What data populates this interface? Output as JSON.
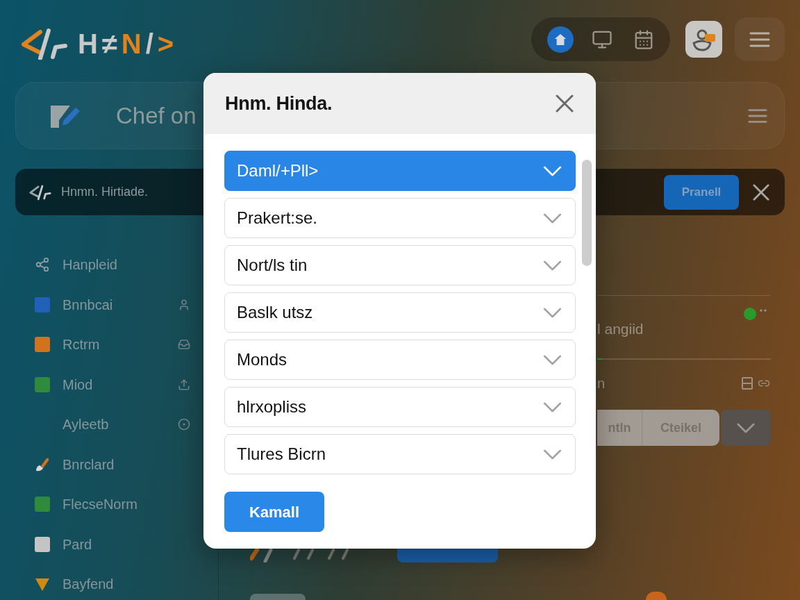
{
  "logo": {
    "parts": [
      {
        "text": "H≠",
        "color": "#c9c9c9"
      },
      {
        "text": "N",
        "color": "#e0831c"
      },
      {
        "text": "/",
        "color": "#c9c9c9"
      },
      {
        "text": ">",
        "color": "#e0831c"
      }
    ]
  },
  "toolbar": [
    {
      "kind": "home",
      "selected": true
    },
    {
      "kind": "monitor",
      "selected": false
    },
    {
      "kind": "calendar",
      "selected": false
    }
  ],
  "page_header": {
    "title": "Chef on"
  },
  "notice_bar": {
    "text": "Hnmn. Hirtiade.",
    "button": "Pranell"
  },
  "sidebar": {
    "items": [
      {
        "label": "Hanpleid",
        "kind": "share"
      },
      {
        "label": "Bnnbcai",
        "kind": "tile",
        "color": "#2160b8",
        "trailing_icon": {
          "kind": "person"
        }
      },
      {
        "label": "Rctrm",
        "kind": "tile",
        "color": "#d0731f",
        "trailing_icon": {
          "kind": "inbox"
        }
      },
      {
        "label": "Miod",
        "kind": "tile",
        "color": "#2f8a3c",
        "trailing_icon": {
          "kind": "upload"
        }
      },
      {
        "label": "Ayleetb",
        "trailing_icon": {
          "kind": "target"
        }
      },
      {
        "label": "Bnrclard",
        "kind": "brush",
        "color": "#d0731f"
      },
      {
        "label": "FlecseNorm",
        "kind": "tile",
        "color": "#2f8a3c"
      },
      {
        "label": "Pard",
        "kind": "tile",
        "color": "#c4c4c4"
      },
      {
        "label": "Bayfend",
        "kind": "triangle",
        "color": "#d08a10"
      }
    ]
  },
  "details": {
    "status": {
      "text": "l angiid",
      "online": true
    },
    "progress": {
      "level": 0.03
    },
    "row_label": "n",
    "segments": [
      {
        "label": "ntln"
      },
      {
        "label": "Cteikel"
      }
    ]
  },
  "dialog": {
    "title": "Hnm. Hinda.",
    "options": [
      {
        "label": "Daml/+Pll>",
        "selected": true
      },
      {
        "label": "Prakert:se.",
        "selected": false
      },
      {
        "label": "Nort/ls tin",
        "selected": false
      },
      {
        "label": "Baslk utsz",
        "selected": false
      },
      {
        "label": "Monds",
        "selected": false
      },
      {
        "label": "hlrxopliss",
        "selected": false
      },
      {
        "label": "Tlures Bicrn",
        "selected": false
      }
    ],
    "button": "Kamall"
  }
}
